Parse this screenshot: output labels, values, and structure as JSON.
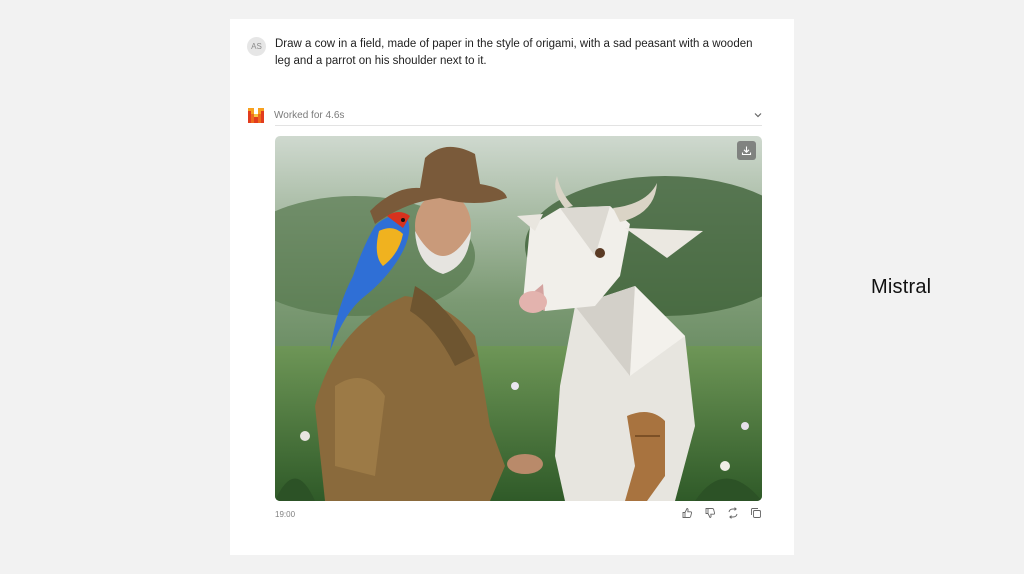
{
  "user": {
    "avatar_initials": "AS",
    "prompt": "Draw a cow in a field, made of paper in the style of origami, with a sad peasant with a wooden leg and a parrot on his shoulder next to it."
  },
  "response": {
    "status": "Worked for 4.6s",
    "timestamp": "19:00",
    "image_icon": "download-icon"
  },
  "actions": [
    "thumbs-up-icon",
    "thumbs-down-icon",
    "regenerate-icon",
    "copy-icon"
  ],
  "brand": {
    "label": "Mistral"
  },
  "colors": {
    "background": "#f2f2f2",
    "panel": "#ffffff",
    "logo_orange": "#f7a01f",
    "logo_red": "#e23c1e"
  }
}
